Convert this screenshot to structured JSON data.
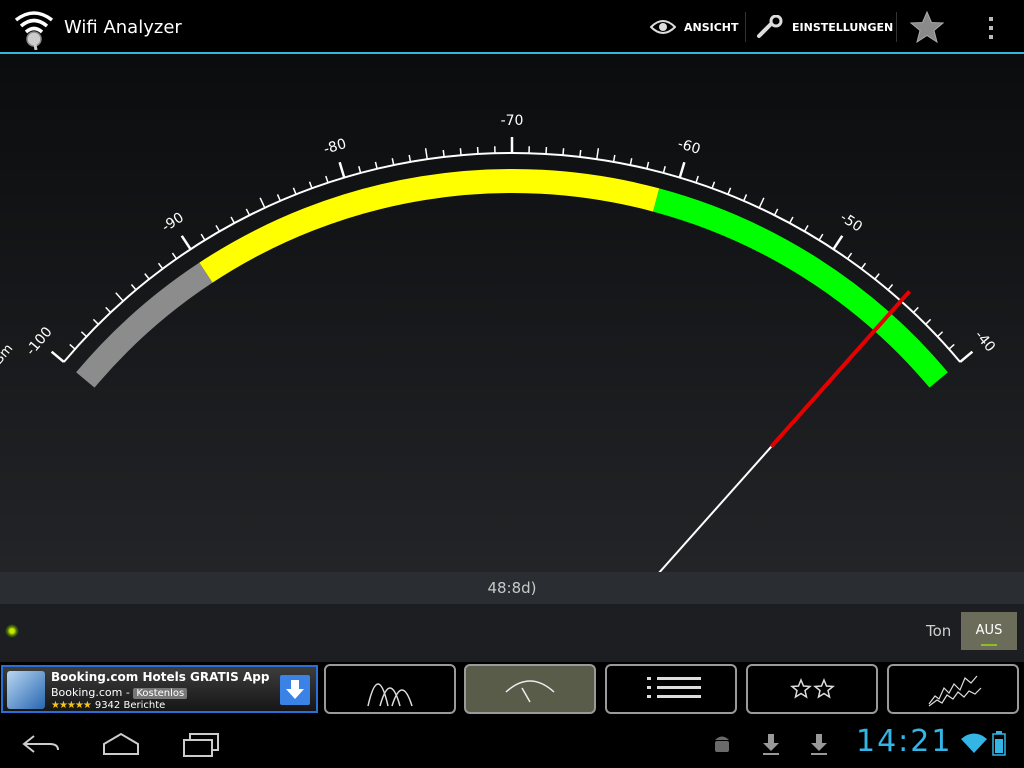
{
  "app": {
    "title": "Wifi Analyzer"
  },
  "actions": {
    "view_label": "ANSICHT",
    "settings_label": "EINSTELLUNGEN"
  },
  "meter": {
    "unit_label": "dBm",
    "scale_min": -100,
    "scale_max": -40,
    "major_labels": [
      "-100",
      "-90",
      "-80",
      "-70",
      "-60",
      "-50",
      "-40"
    ],
    "zones": [
      {
        "from": -100,
        "to": -90,
        "color": "#8c8c8c"
      },
      {
        "from": -90,
        "to": -61,
        "color": "#ffff00"
      },
      {
        "from": -61,
        "to": -40,
        "color": "#00ff00"
      }
    ],
    "needle_value": -45
  },
  "network": {
    "ssid": "48:8d)"
  },
  "sound": {
    "label": "Ton",
    "state": "AUS"
  },
  "ad": {
    "title": "Booking.com Hotels GRATIS App",
    "advertiser": "Booking.com -",
    "badge": "Kostenlos",
    "stars": "★★★★★",
    "reviews": "9342 Berichte"
  },
  "tabs": [
    {
      "name": "channel-graph",
      "active": false
    },
    {
      "name": "signal-meter",
      "active": true
    },
    {
      "name": "ap-list",
      "active": false
    },
    {
      "name": "channel-rating",
      "active": false
    },
    {
      "name": "time-graph",
      "active": false
    }
  ],
  "status": {
    "clock": "14:21"
  }
}
